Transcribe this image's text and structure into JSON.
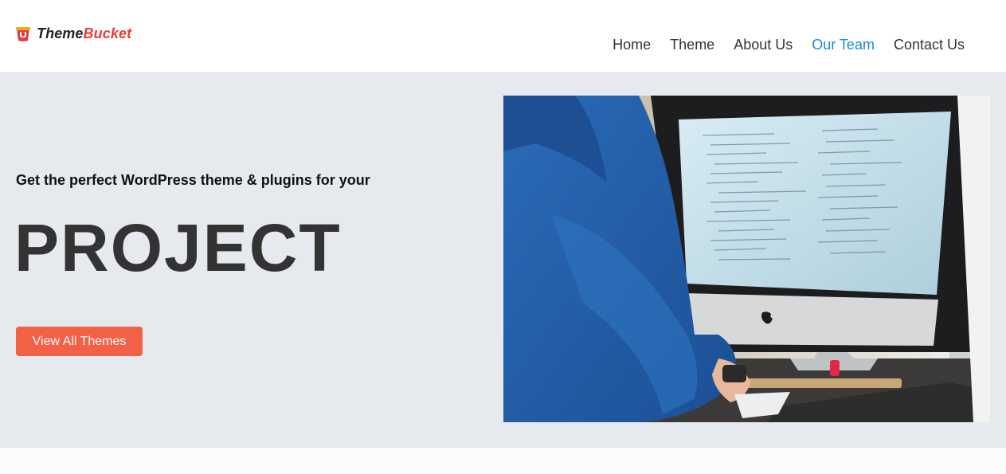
{
  "brand": {
    "name_part1": "Theme",
    "name_part2": "Bucket",
    "icon": "bucket-logo-icon",
    "accent_color": "#e53d3d"
  },
  "nav": {
    "items": [
      {
        "label": "Home",
        "active": false
      },
      {
        "label": "Theme",
        "active": false
      },
      {
        "label": "About Us",
        "active": false
      },
      {
        "label": "Our Team",
        "active": true
      },
      {
        "label": "Contact Us",
        "active": false
      }
    ],
    "active_color": "#1a8ad4"
  },
  "hero": {
    "tagline": "Get the perfect WordPress theme & plugins for your",
    "headline": "PROJECT",
    "cta_label": "View All Themes",
    "cta_color": "#f26046",
    "background": "#e6e9ee"
  }
}
